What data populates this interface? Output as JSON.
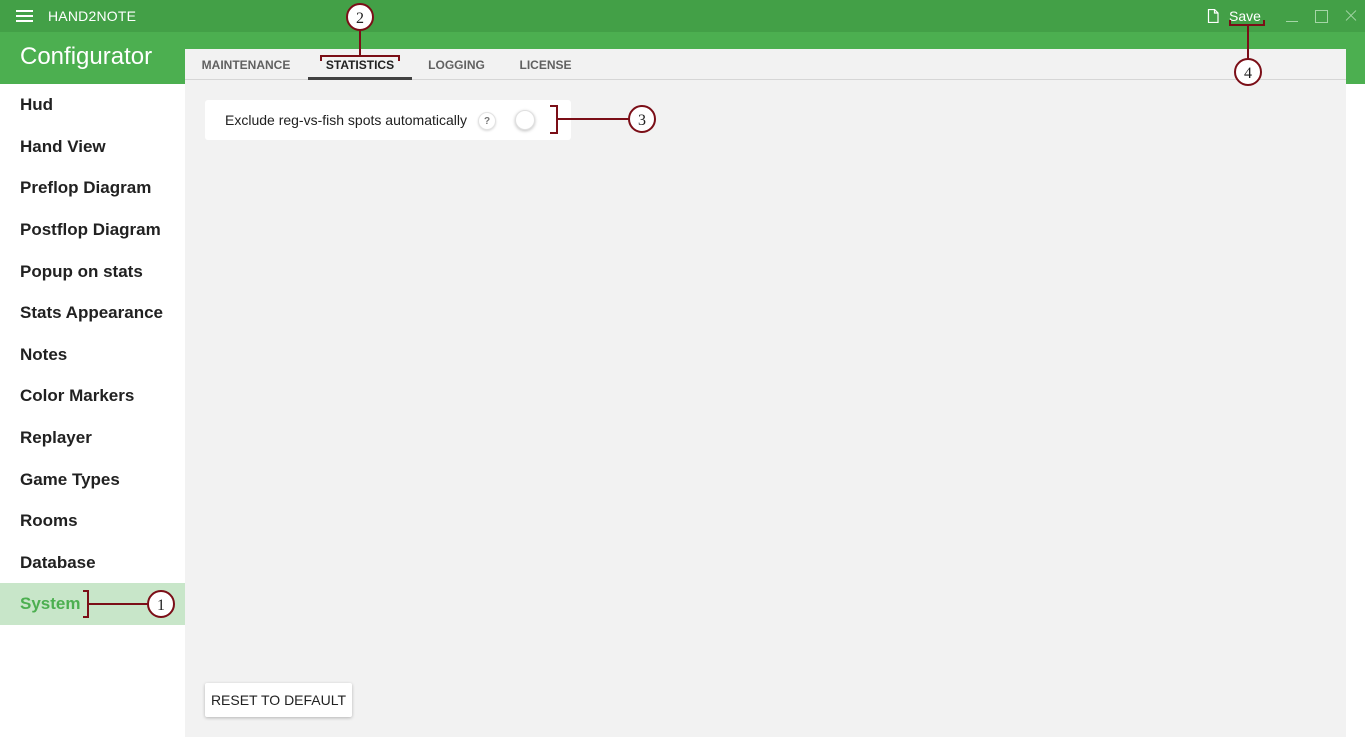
{
  "window": {
    "title": "HAND2NOTE",
    "save_label": "Save",
    "menu_icon": "hamburger-menu-icon",
    "save_icon": "document-icon",
    "accent_color": "#43a047"
  },
  "header": {
    "title": "Configurator"
  },
  "sidebar": {
    "items": [
      {
        "label": "Hud"
      },
      {
        "label": "Hand View"
      },
      {
        "label": "Preflop Diagram"
      },
      {
        "label": "Postflop Diagram"
      },
      {
        "label": "Popup on stats"
      },
      {
        "label": "Stats Appearance"
      },
      {
        "label": "Notes"
      },
      {
        "label": "Color Markers"
      },
      {
        "label": "Replayer"
      },
      {
        "label": "Game Types"
      },
      {
        "label": "Rooms"
      },
      {
        "label": "Database"
      },
      {
        "label": "System"
      }
    ],
    "active": "System",
    "active_color": "#4caf50"
  },
  "tabs": [
    {
      "label": "MAINTENANCE"
    },
    {
      "label": "STATISTICS"
    },
    {
      "label": "LOGGING"
    },
    {
      "label": "LICENSE"
    }
  ],
  "active_tab": "STATISTICS",
  "settings": {
    "exclude_reg_vs_fish": {
      "label": "Exclude reg-vs-fish spots automatically",
      "help": "?",
      "enabled": false
    }
  },
  "footer": {
    "reset_label": "RESET TO DEFAULT"
  },
  "callouts": [
    "1",
    "2",
    "3",
    "4"
  ],
  "callout_color": "#7b0e17"
}
